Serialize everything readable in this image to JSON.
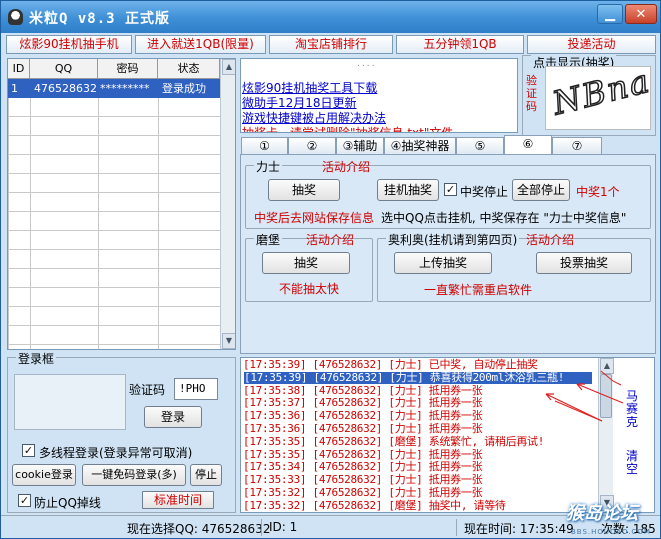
{
  "window": {
    "title": "米粒Q  v8.3  正式版",
    "min_label": "▁",
    "close_label": "✕"
  },
  "promo": [
    "炫影90挂机抽手机",
    "进入就送1QB(限量)",
    "淘宝店铺排行",
    "五分钟领1QB",
    "投递活动"
  ],
  "accounts": {
    "columns": [
      "ID",
      "QQ",
      "密码",
      "状态"
    ],
    "rows": [
      {
        "id": "1",
        "qq": "476528632",
        "password": "*********",
        "status": "登录成功"
      }
    ]
  },
  "news": {
    "dots": "....",
    "items": [
      "炫影90挂机抽奖工具下载",
      "微助手12月18日更新",
      "游戏快捷键被占用解决办法",
      "抽奖卡，请尝试删除\"抽奖信息.txt\"文件"
    ]
  },
  "captcha": {
    "title": "点击显示(抽奖)",
    "label": "验证码",
    "text": "NBna"
  },
  "tabs": [
    "①",
    "②",
    "③辅助",
    "④抽奖神器",
    "⑤",
    "⑥",
    "⑦"
  ],
  "panel": {
    "lishi": {
      "title": "力士",
      "activity": "活动介绍",
      "draw_button": "抽奖",
      "hang_button": "挂机抽奖",
      "stop_checkbox": "中奖停止",
      "stop_all_button": "全部停止",
      "winner_count": "中奖1个",
      "notice": "中奖后去网站保存信息",
      "hint": "选中QQ点击挂机, 中奖保存在 \"力士中奖信息\""
    },
    "mobao": {
      "title": "磨堡",
      "activity": "活动介绍",
      "draw_button": "抽奖",
      "warning": "不能抽太快"
    },
    "olympics": {
      "title": "奥利奥(挂机请到第四页)",
      "activity": "活动介绍",
      "upload_button": "上传抽奖",
      "vote_button": "投票抽奖",
      "warning": "一直繁忙需重启软件"
    }
  },
  "login": {
    "title": "登录框",
    "captcha_label": "验证码",
    "captcha_value": "!PHO",
    "login_button": "登录",
    "multi_thread": "多线程登录(登录异常可取消)",
    "cookie_button": "cookie登录",
    "one_key_button": "一键免码登录(多)",
    "stop_button": "停止",
    "anti_drop": "防止QQ掉线",
    "std_time_button": "标准时间"
  },
  "log": {
    "lines": [
      "[17:35:39] [476528632] [力士] 已中奖, 自动停止抽奖",
      "[17:35:39] [476528632] [力士] 恭喜获得200ml沐浴乳三瓶!",
      "[17:35:38] [476528632] [力士] 抵用券一张",
      "[17:35:37] [476528632] [力士] 抵用券一张",
      "[17:35:36] [476528632] [力士] 抵用券一张",
      "[17:35:36] [476528632] [力士] 抵用券一张",
      "[17:35:35] [476528632] [磨堡] 系统繁忙, 请稍后再试!",
      "[17:35:35] [476528632] [力士] 抵用券一张",
      "[17:35:34] [476528632] [力士] 抵用券一张",
      "[17:35:33] [476528632] [力士] 抵用券一张",
      "[17:35:32] [476528632] [力士] 抵用券一张",
      "[17:35:32] [476528632] [磨堡] 抽奖中, 请等待"
    ],
    "selected_index": 1,
    "mosaic_link": "马赛克",
    "clear_link": "清空"
  },
  "status": {
    "selected_qq": "现在选择QQ: 476528632",
    "id": "ID:  1",
    "time": "现在时间: 17:35:49",
    "count": "次数: 185"
  },
  "watermark": {
    "text": "猴岛论坛",
    "sub": "BBS.HOUDAO.COM"
  },
  "colors": {
    "accent_red": "#d00000",
    "link_blue": "#0000cc",
    "selection": "#2f61c0",
    "window_bg": "#cfe3f4"
  }
}
